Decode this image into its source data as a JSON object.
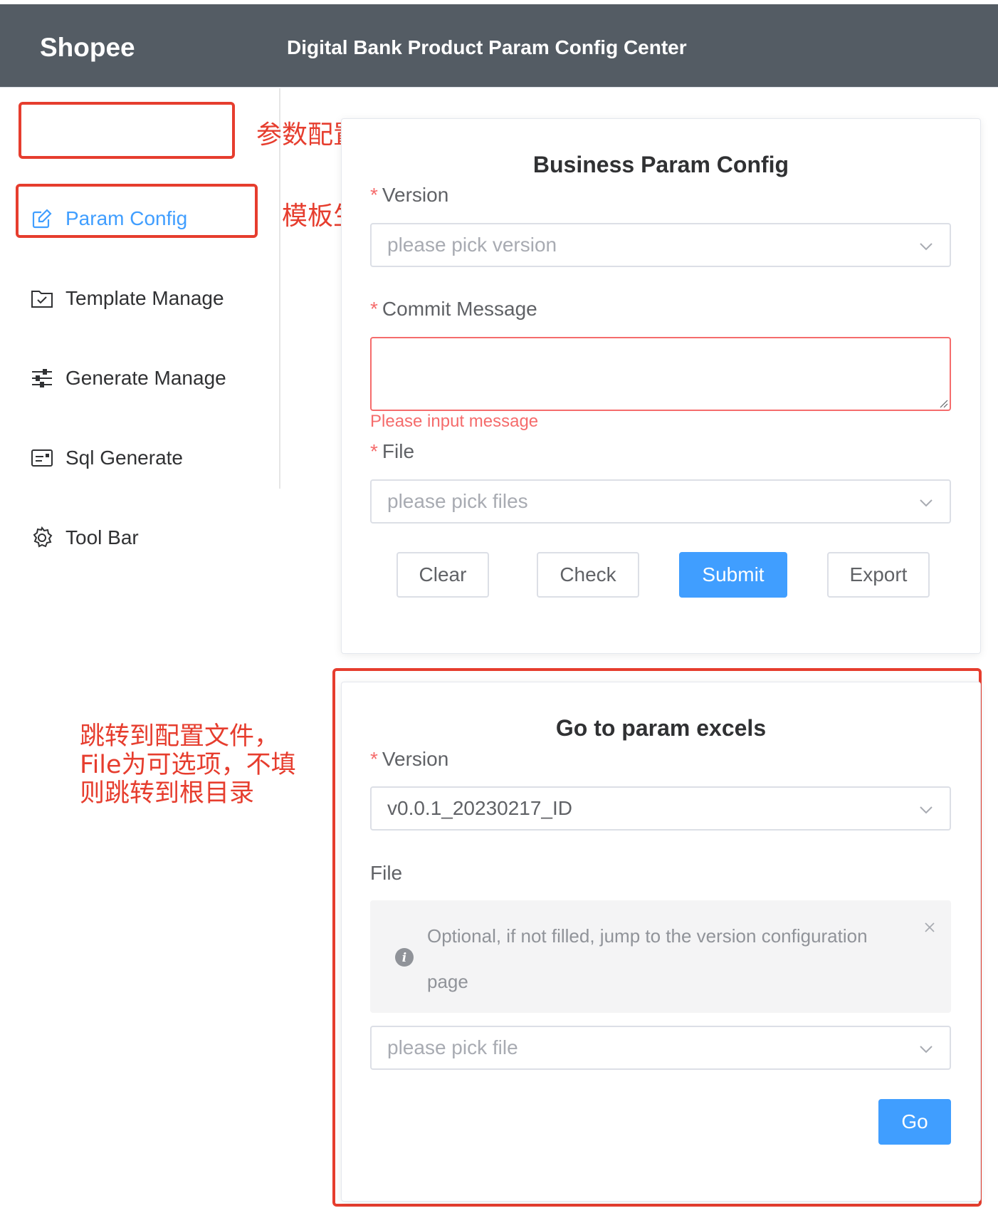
{
  "header": {
    "brand": "Shopee",
    "title": "Digital Bank Product Param Config Center"
  },
  "sidebar": {
    "items": [
      {
        "label": "Param Config",
        "icon": "edit-icon"
      },
      {
        "label": "Template Manage",
        "icon": "folder-check-icon"
      },
      {
        "label": "Generate Manage",
        "icon": "sliders-icon"
      },
      {
        "label": "Sql Generate",
        "icon": "document-icon"
      },
      {
        "label": "Tool Bar",
        "icon": "gear-icon"
      }
    ]
  },
  "annotations": {
    "param_page": "参数配置页面",
    "template_page": "模板生成页面",
    "jump_note": [
      "跳转到配置文件，",
      "File为可选项，不填",
      "则跳转到根目录"
    ]
  },
  "business_form": {
    "title": "Business Param Config",
    "required_mark": "*",
    "version_label": "Version",
    "version_placeholder": "please pick version",
    "commit_label": "Commit Message",
    "commit_error": "Please input message",
    "file_label": "File",
    "file_placeholder": "please pick files",
    "buttons": {
      "clear": "Clear",
      "check": "Check",
      "submit": "Submit",
      "export": "Export"
    }
  },
  "goto_form": {
    "title": "Go to param excels",
    "required_mark": "*",
    "version_label": "Version",
    "version_value": "v0.0.1_20230217_ID",
    "file_label": "File",
    "alert_text": "Optional, if not filled, jump to the version configuration page",
    "file_placeholder": "please pick file",
    "go_button": "Go"
  },
  "colors": {
    "header_bg": "#545c64",
    "primary": "#409eff",
    "error": "#f56c6c",
    "annotation": "#e63d2e"
  }
}
